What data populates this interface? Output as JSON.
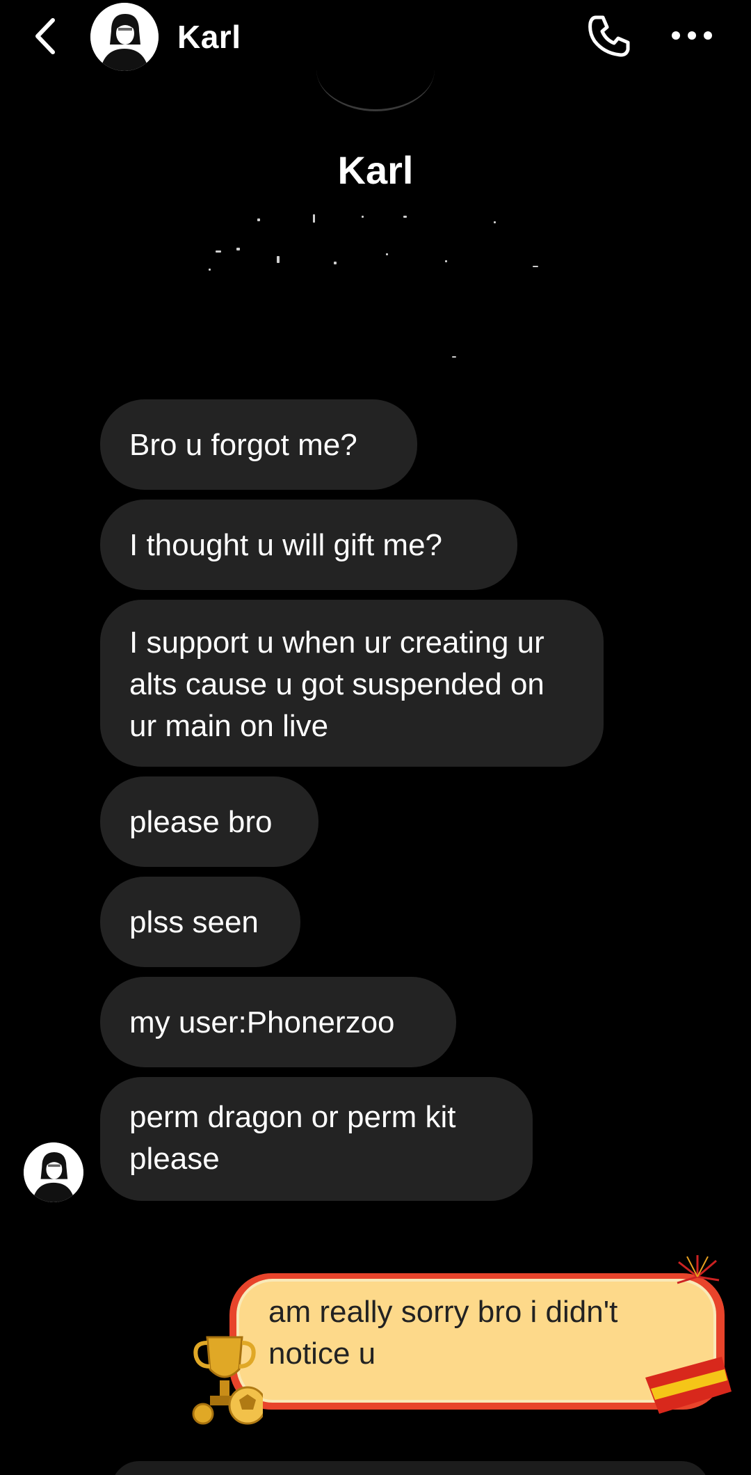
{
  "header": {
    "contact_name": "Karl",
    "icons": {
      "back": "chevron-left-icon",
      "call": "phone-icon",
      "more": "more-horizontal-icon"
    }
  },
  "profile": {
    "name": "Karl"
  },
  "messages": {
    "received": [
      "Bro u forgot me?",
      "I thought u will gift me?",
      "I support u when ur creating ur alts cause u got suspended on ur main on live",
      "please bro",
      "plss seen",
      "my user:Phonerzoo",
      "perm dragon or perm kit please"
    ],
    "sent": [
      "am really sorry bro i didn't notice u"
    ]
  },
  "colors": {
    "background": "#000000",
    "received_bubble": "#232323",
    "sent_bubble_fill": "#fdd98a",
    "sent_bubble_frame": "#e8442b"
  }
}
